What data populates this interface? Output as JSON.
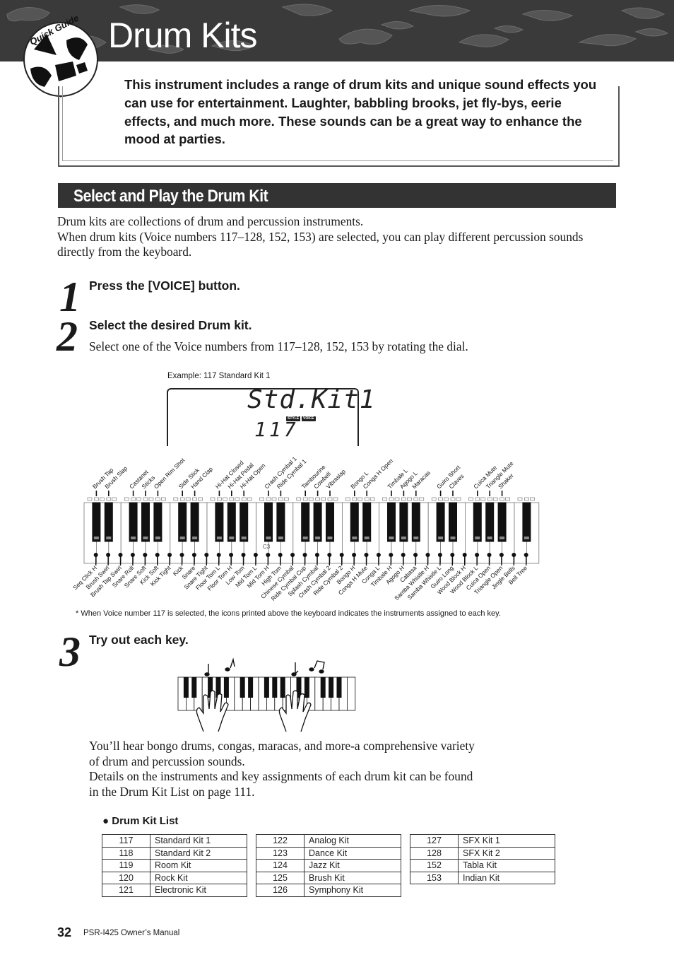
{
  "header": {
    "badge": "Quick Guide",
    "title": "Drum Kits"
  },
  "intro": {
    "text": "This instrument includes a range of drum kits and unique sound effects you can use for entertainment. Laughter, babbling brooks, jet fly-bys, eerie effects, and much more. These sounds can be a great way to enhance the mood at parties."
  },
  "section": {
    "title": "Select and Play the Drum Kit",
    "paragraph_1": "Drum kits are collections of drum and percussion instruments.",
    "paragraph_2": "When drum kits (Voice numbers 117–128, 152, 153) are selected, you can play different percussion sounds directly from the keyboard."
  },
  "steps": [
    {
      "number": "1",
      "title": "Press the [VOICE] button."
    },
    {
      "number": "2",
      "title": "Select the desired Drum kit.",
      "description": "Select one of the Voice numbers from 117–128, 152, 153 by rotating the dial."
    },
    {
      "number": "3",
      "title": "Try out each key.",
      "description_1": "You’ll hear bongo drums, congas, maracas, and more-a comprehensive variety of drum and percussion sounds.",
      "description_2": "Details on the instruments and key assignments of each drum kit can be found in the Drum Kit List on page 111."
    }
  ],
  "display_example": {
    "caption": "Example: 117 Standard Kit 1",
    "voice_name": "Std.Kit1",
    "voice_number": "117",
    "badges": [
      "STYLE",
      "VOICE"
    ]
  },
  "keyboard": {
    "middle_marker": "C3",
    "black_key_labels": [
      "Brush Tap",
      "Brush Slap",
      "Castanet",
      "Sticks",
      "Open Rim Shot",
      "Side Stick",
      "Hand Clap",
      "Hi-Hat Closed",
      "Hi-Hat Pedal",
      "Hi-Hat Open",
      "Crash Cymbal 1",
      "Ride Cymbal 1",
      "Tambourine",
      "Cowbell",
      "Vibraslap",
      "Bongo L",
      "Conga H Open",
      "Timbale L",
      "Agogo L",
      "Maracas",
      "Guiro Short",
      "Claves",
      "Cuica Mute",
      "Triangle Mute",
      "Shaker"
    ],
    "white_key_labels": [
      "Seq Click H",
      "Brush Swirl",
      "Brush Tap Swirl",
      "Snare Roll",
      "Snare Soft",
      "Kick Soft",
      "Kick Tight",
      "Kick",
      "Snare",
      "Snare Tight",
      "Floor Tom L",
      "Floor Tom H",
      "Low Tom",
      "Mid Tom L",
      "Mid Tom H",
      "High Tom",
      "Chinese Cymbal",
      "Ride Cymbal Cup",
      "Splash Cymbal",
      "Crash Cymbal 2",
      "Ride Cymbal 2",
      "Bongo H",
      "Conga H Mute",
      "Conga L",
      "Timbale H",
      "Agogo H",
      "Cabasa",
      "Samba Whistle H",
      "Samba Whistle L",
      "Guiro Long",
      "Wood Block H",
      "Wood Block L",
      "Cuica Open",
      "Triangle Open",
      "Jingle Bells",
      "Bell Tree"
    ],
    "footnote": "* When Voice number 117 is selected, the icons printed above the keyboard indicates the instruments assigned to each key."
  },
  "drum_kit_list": {
    "title": "Drum Kit List",
    "tables": [
      [
        {
          "number": "117",
          "name": "Standard Kit 1"
        },
        {
          "number": "118",
          "name": "Standard Kit 2"
        },
        {
          "number": "119",
          "name": "Room Kit"
        },
        {
          "number": "120",
          "name": "Rock Kit"
        },
        {
          "number": "121",
          "name": "Electronic Kit"
        }
      ],
      [
        {
          "number": "122",
          "name": "Analog Kit"
        },
        {
          "number": "123",
          "name": "Dance Kit"
        },
        {
          "number": "124",
          "name": "Jazz Kit"
        },
        {
          "number": "125",
          "name": "Brush Kit"
        },
        {
          "number": "126",
          "name": "Symphony Kit"
        }
      ],
      [
        {
          "number": "127",
          "name": "SFX Kit 1"
        },
        {
          "number": "128",
          "name": "SFX Kit 2"
        },
        {
          "number": "152",
          "name": "Tabla Kit"
        },
        {
          "number": "153",
          "name": "Indian Kit"
        }
      ]
    ]
  },
  "footer": {
    "page_number": "32",
    "manual_name": "PSR-I425  Owner’s Manual"
  }
}
